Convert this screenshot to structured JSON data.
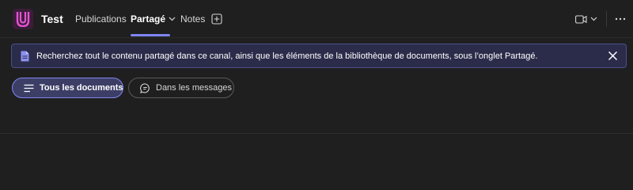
{
  "header": {
    "team_name": "Test",
    "logo_icon": "teams-letter-u-logo",
    "tabs": [
      {
        "label": "Publications",
        "active": false
      },
      {
        "label": "Partagé",
        "active": true,
        "has_dropdown": true
      },
      {
        "label": "Notes",
        "active": false
      }
    ],
    "add_tab_icon": "plus-square-icon",
    "video_icon": "video-camera-icon",
    "more_icon": "more-horizontal-icon"
  },
  "banner": {
    "icon": "document-icon",
    "text": "Recherchez tout le contenu partagé dans ce canal, ainsi que les éléments de la bibliothèque de documents, sous l’onglet Partagé.",
    "close_icon": "close-icon"
  },
  "filters": [
    {
      "label": "Tous les documents",
      "icon": "list-icon",
      "selected": true
    },
    {
      "label": "Dans les messages",
      "icon": "chat-bubble-icon",
      "selected": false
    }
  ],
  "colors": {
    "background": "#1f1f1f",
    "accent": "#7f85f5",
    "banner_bg": "#2b2c4a",
    "banner_border": "#4b4e8c",
    "logo_pink": "#e552d2"
  }
}
